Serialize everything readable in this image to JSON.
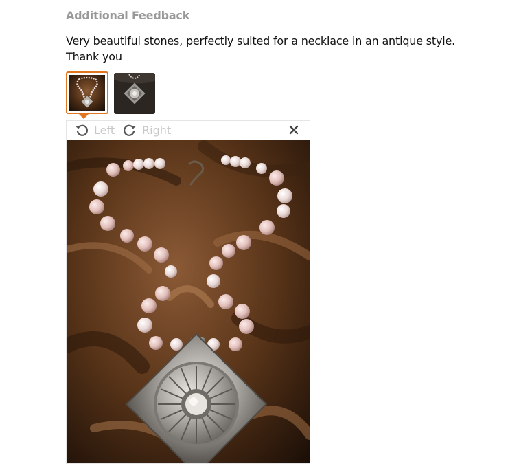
{
  "review": {
    "heading": "Additional Feedback",
    "comment": "Very beautiful stones, perfectly suited for a necklace in an antique style. Thank you"
  },
  "thumbnails": [
    {
      "name": "photo-1",
      "selected": true
    },
    {
      "name": "photo-2",
      "selected": false
    }
  ],
  "viewer": {
    "rotate_left_label": "Left",
    "rotate_right_label": "Right",
    "close_icon": "close-icon",
    "rotate_left_icon": "rotate-left-icon",
    "rotate_right_icon": "rotate-right-icon"
  },
  "colors": {
    "accent": "#e2771f",
    "heading": "#999999",
    "muted_label": "#c8c8c8"
  }
}
